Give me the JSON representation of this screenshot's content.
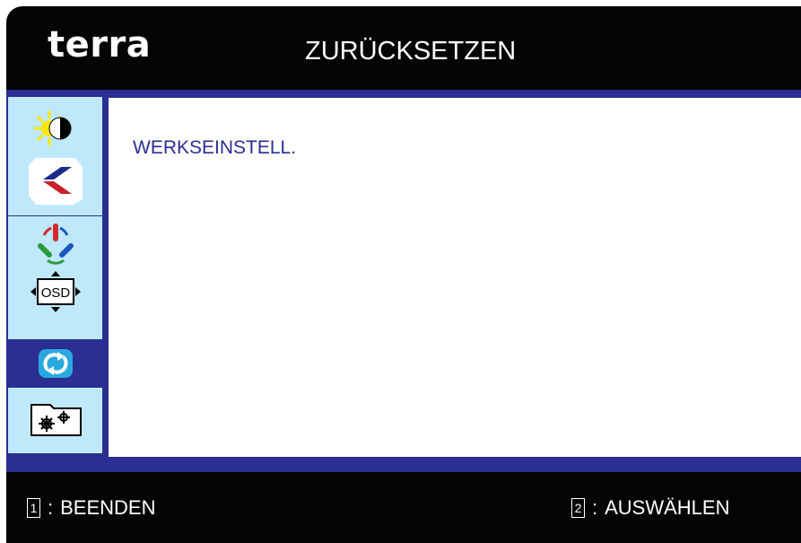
{
  "header": {
    "brand": "terra",
    "title": "ZURÜCKSETZEN"
  },
  "sidebar": {
    "items": [
      {
        "icon": "brightness-contrast-icon",
        "active": false
      },
      {
        "icon": "image-position-icon",
        "active": false
      },
      {
        "icon": "color-icon",
        "active": false
      },
      {
        "icon": "osd-settings-icon",
        "active": false,
        "label": "OSD"
      },
      {
        "icon": "reset-icon",
        "active": true
      },
      {
        "icon": "extra-settings-icon",
        "active": false
      }
    ]
  },
  "content": {
    "option_label": "WERKSEINSTELL."
  },
  "footer": {
    "left": {
      "key": "1",
      "separator": ":",
      "label": "BEENDEN"
    },
    "right": {
      "key": "2",
      "separator": ":",
      "label": "AUSWÄHLEN"
    }
  },
  "colors": {
    "frame": "#050505",
    "accent": "#2b2e92",
    "sidebar": "#bfe9fb",
    "panel": "#ffffff"
  }
}
